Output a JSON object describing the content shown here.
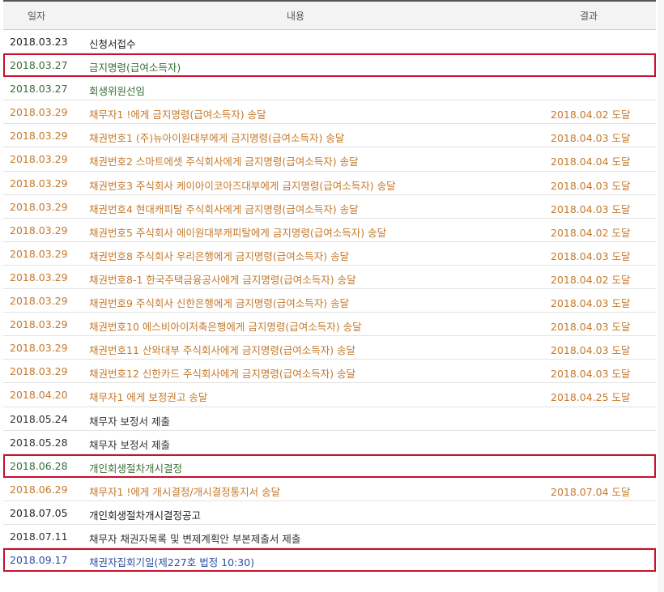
{
  "headers": {
    "date": "일자",
    "content": "내용",
    "result": "결과"
  },
  "rows": [
    {
      "date": "2018.03.23",
      "content": "신청서접수",
      "result": "",
      "color": "black",
      "highlight": false
    },
    {
      "date": "2018.03.27",
      "content": "금지명령(급여소득자)",
      "result": "",
      "color": "green",
      "highlight": true
    },
    {
      "date": "2018.03.27",
      "content": "회생위원선임",
      "result": "",
      "color": "green",
      "highlight": false
    },
    {
      "date": "2018.03.29",
      "content": "채무자1 !에게 금지명령(급여소득자) 송달",
      "result": "2018.04.02 도달",
      "color": "orange",
      "highlight": false
    },
    {
      "date": "2018.03.29",
      "content": "채권번호1 (주)뉴아이원대부에게 금지명령(급여소득자) 송달",
      "result": "2018.04.03 도달",
      "color": "orange",
      "highlight": false
    },
    {
      "date": "2018.03.29",
      "content": "채권번호2 스마트에셋 주식회사에게 금지명령(급여소득자) 송달",
      "result": "2018.04.04 도달",
      "color": "orange",
      "highlight": false
    },
    {
      "date": "2018.03.29",
      "content": "채권번호3 주식회사 케이아이코아즈대부에게 금지명령(급여소득자) 송달",
      "result": "2018.04.03 도달",
      "color": "orange",
      "highlight": false
    },
    {
      "date": "2018.03.29",
      "content": "채권번호4 현대캐피탈 주식회사에게 금지명령(급여소득자) 송달",
      "result": "2018.04.03 도달",
      "color": "orange",
      "highlight": false
    },
    {
      "date": "2018.03.29",
      "content": "채권번호5 주식회사 에이원대부캐피탈에게 금지명령(급여소득자) 송달",
      "result": "2018.04.02 도달",
      "color": "orange",
      "highlight": false
    },
    {
      "date": "2018.03.29",
      "content": "채권번호8 주식회사 우리은행에게 금지명령(급여소득자) 송달",
      "result": "2018.04.03 도달",
      "color": "orange",
      "highlight": false
    },
    {
      "date": "2018.03.29",
      "content": "채권번호8-1 한국주택금융공사에게 금지명령(급여소득자) 송달",
      "result": "2018.04.02 도달",
      "color": "orange",
      "highlight": false
    },
    {
      "date": "2018.03.29",
      "content": "채권번호9 주식회사 신한은행에게 금지명령(급여소득자) 송달",
      "result": "2018.04.03 도달",
      "color": "orange",
      "highlight": false
    },
    {
      "date": "2018.03.29",
      "content": "채권번호10 에스비아이저축은행에게 금지명령(급여소득자) 송달",
      "result": "2018.04.03 도달",
      "color": "orange",
      "highlight": false
    },
    {
      "date": "2018.03.29",
      "content": "채권번호11 산와대부 주식회사에게 금지명령(급여소득자) 송달",
      "result": "2018.04.03 도달",
      "color": "orange",
      "highlight": false
    },
    {
      "date": "2018.03.29",
      "content": "채권번호12 신한카드 주식회사에게 금지명령(급여소득자) 송달",
      "result": "2018.04.03 도달",
      "color": "orange",
      "highlight": false
    },
    {
      "date": "2018.04.20",
      "content": "채무자1 에게 보정권고 송달",
      "result": "2018.04.25 도달",
      "color": "orange",
      "highlight": false
    },
    {
      "date": "2018.05.24",
      "content": "채무자 보정서 제출",
      "result": "",
      "color": "dark",
      "highlight": false
    },
    {
      "date": "2018.05.28",
      "content": "채무자 보정서 제출",
      "result": "",
      "color": "dark",
      "highlight": false
    },
    {
      "date": "2018.06.28",
      "content": "개인회생절차개시결정",
      "result": "",
      "color": "green",
      "highlight": true
    },
    {
      "date": "2018.06.29",
      "content": "채무자1 !에게 개시결정/개시결정통지서 송달",
      "result": "2018.07.04 도달",
      "color": "orange",
      "highlight": false
    },
    {
      "date": "2018.07.05",
      "content": "개인회생절차개시결정공고",
      "result": "",
      "color": "black",
      "highlight": false
    },
    {
      "date": "2018.07.11",
      "content": "채무자 채권자목록 및 변제계획안 부본제출서 제출",
      "result": "",
      "color": "dark",
      "highlight": false
    },
    {
      "date": "2018.09.17",
      "content": "채권자집회기일(제227호 법정 10:30)",
      "result": "",
      "color": "blue",
      "highlight": true
    }
  ],
  "colors": {
    "highlight": "#c8102e",
    "green": "#3a6e37",
    "orange": "#c5792b",
    "blue": "#2b4fa0",
    "black": "#222222"
  }
}
